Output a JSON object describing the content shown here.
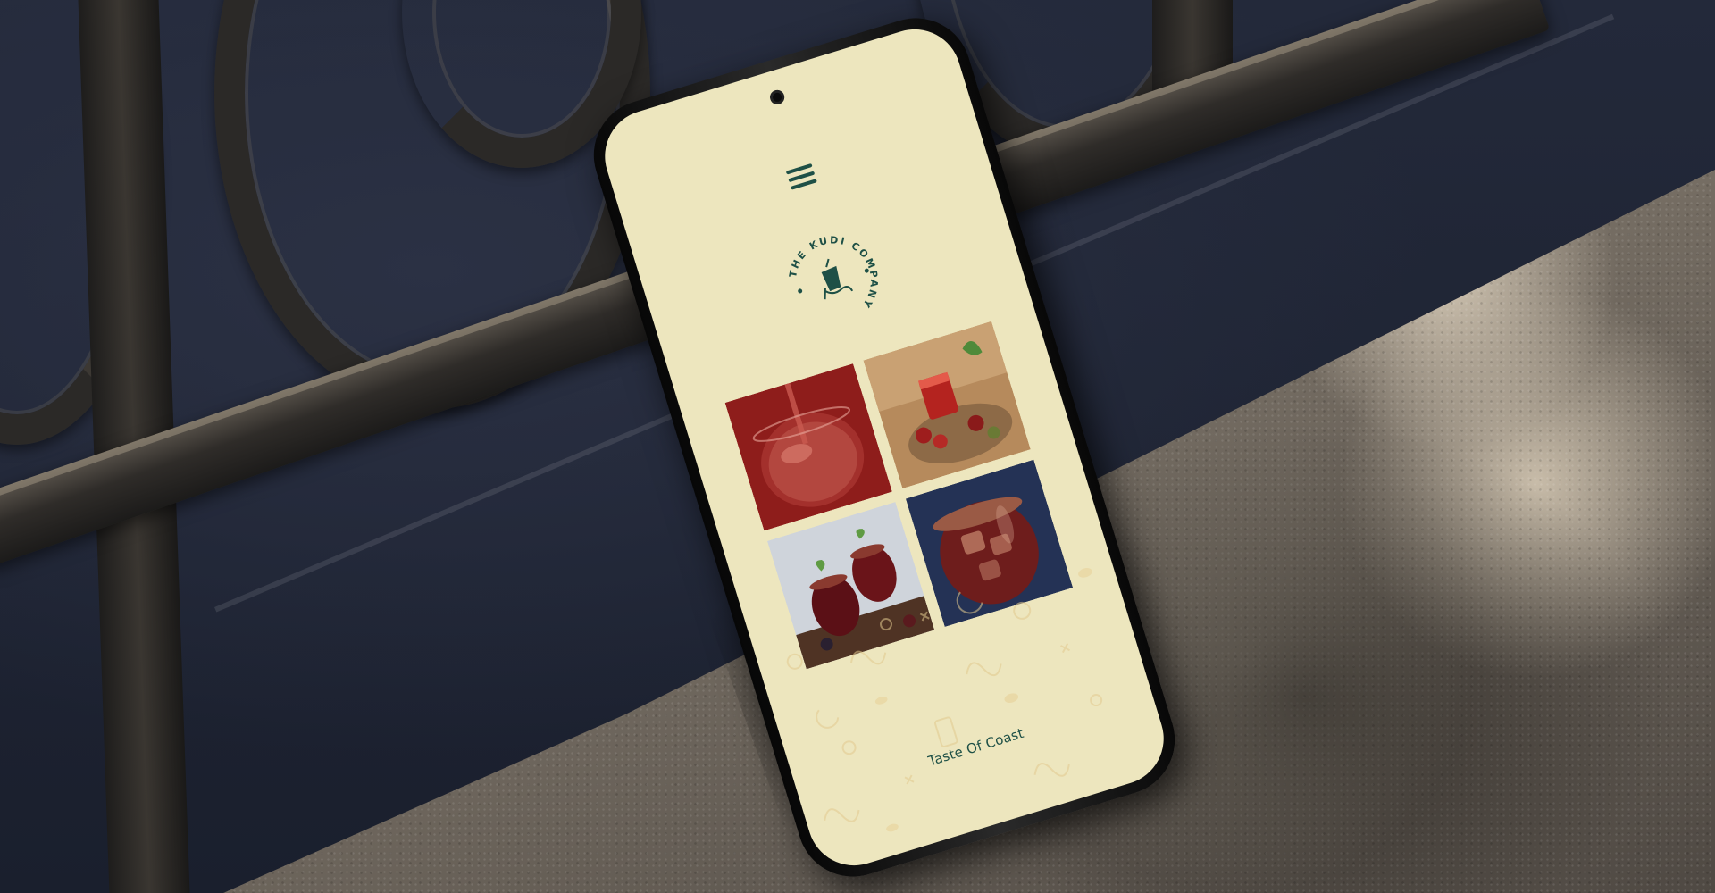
{
  "brand": {
    "name": "THE KUDI COMPANY",
    "tagline": "Taste Of Coast",
    "primary_color": "#1e5046",
    "background_color": "#ede6be"
  },
  "header": {
    "menu_icon": "hamburger-menu-icon"
  },
  "gallery": {
    "photos": [
      "red-drink-pour-photo",
      "drink-with-fruits-photo",
      "two-glasses-mint-photo",
      "iced-red-drink-photo"
    ]
  }
}
